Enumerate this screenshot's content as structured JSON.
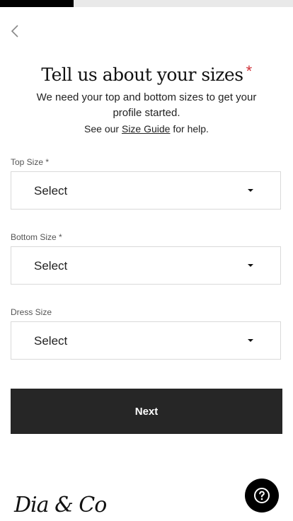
{
  "progress": {
    "fraction": 0.25
  },
  "header": {
    "back_icon": "chevron-left-icon",
    "title": "Tell us about your sizes",
    "required_marker": "*"
  },
  "intro": {
    "line": "We need your top and bottom sizes to get your profile started.",
    "help_prefix": "See our ",
    "size_guide_link": "Size Guide",
    "help_suffix": " for help."
  },
  "fields": [
    {
      "label": "Top Size *",
      "value": "Select",
      "icon": "caret-down-icon"
    },
    {
      "label": "Bottom Size *",
      "value": "Select",
      "icon": "caret-down-icon"
    },
    {
      "label": "Dress Size",
      "value": "Select",
      "icon": "caret-down-icon"
    }
  ],
  "actions": {
    "next_label": "Next"
  },
  "footer": {
    "logo_text": "Dia & Co",
    "help_icon": "question-circle-icon"
  },
  "colors": {
    "accent_required": "#d0323a",
    "button_bg": "#262626",
    "progress_fill": "#000000",
    "progress_track": "#e9e9e9"
  }
}
